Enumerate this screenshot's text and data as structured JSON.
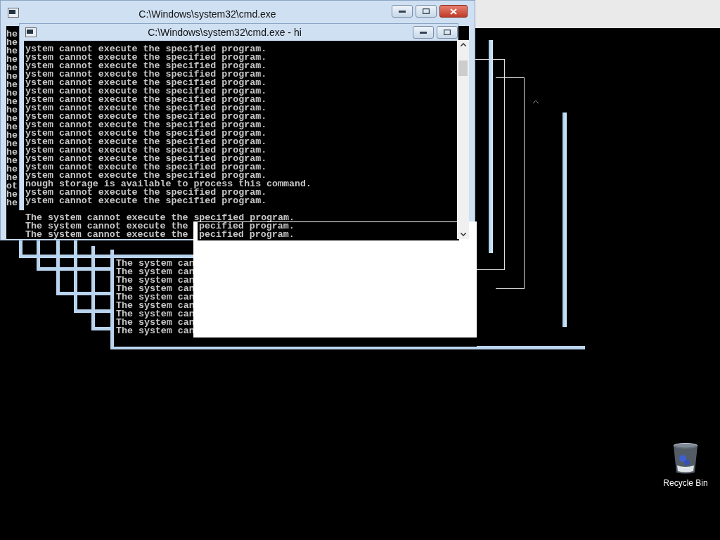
{
  "back_window": {
    "title": "C:\\Windows\\system32\\cmd.exe",
    "edge_lines": [
      "he",
      "he",
      "he",
      "he",
      "he",
      "he",
      "he",
      "he",
      "he",
      "he",
      "he",
      "he",
      "he",
      "he",
      "he",
      "he",
      "he",
      "he",
      "ot",
      "he",
      "he"
    ],
    "bottom_lines": [
      "The system cannot execute the specified program.",
      "The system cannot execute the",
      "The system cannot execute the"
    ]
  },
  "front_window": {
    "title": "C:\\Windows\\system32\\cmd.exe - hi",
    "lines": [
      "ystem cannot execute the specified program.",
      "ystem cannot execute the specified program.",
      "ystem cannot execute the specified program.",
      "ystem cannot execute the specified program.",
      "ystem cannot execute the specified program.",
      "ystem cannot execute the specified program.",
      "ystem cannot execute the specified program.",
      "ystem cannot execute the specified program.",
      "ystem cannot execute the specified program.",
      "ystem cannot execute the specified program.",
      "ystem cannot execute the specified program.",
      "ystem cannot execute the specified program.",
      "ystem cannot execute the specified program.",
      "ystem cannot execute the specified program.",
      "ystem cannot execute the specified program.",
      "ystem cannot execute the specified program.",
      "nough storage is available to process this command.",
      "ystem cannot execute the specified program.",
      "ystem cannot execute the specified program."
    ]
  },
  "ghost_panel": {
    "lines": [
      "pecified program.",
      "pecified program."
    ]
  },
  "ghost_console": {
    "lines": [
      "The system can",
      "The system can",
      "The system can",
      "The system can",
      "The system can",
      "The system can",
      "The system can",
      "The system can",
      "The system can"
    ]
  },
  "desktop_icons": [
    {
      "label": "Recycle Bin"
    }
  ]
}
